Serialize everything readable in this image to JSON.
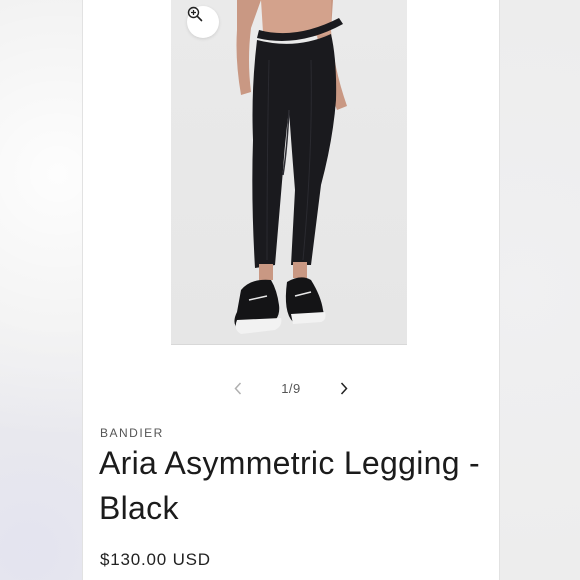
{
  "product": {
    "vendor": "BANDIER",
    "title": "Aria Asymmetric Legging - Black",
    "price": "$130.00 USD"
  },
  "gallery": {
    "current": 1,
    "total": 9,
    "counter_text": "1/9"
  },
  "icons": {
    "zoom": "zoom-in-icon",
    "prev": "chevron-left-icon",
    "next": "chevron-right-icon"
  },
  "colors": {
    "legging": "#1a1a1e",
    "photo_bg": "#e8e8e8",
    "text": "#1b1b1b"
  }
}
